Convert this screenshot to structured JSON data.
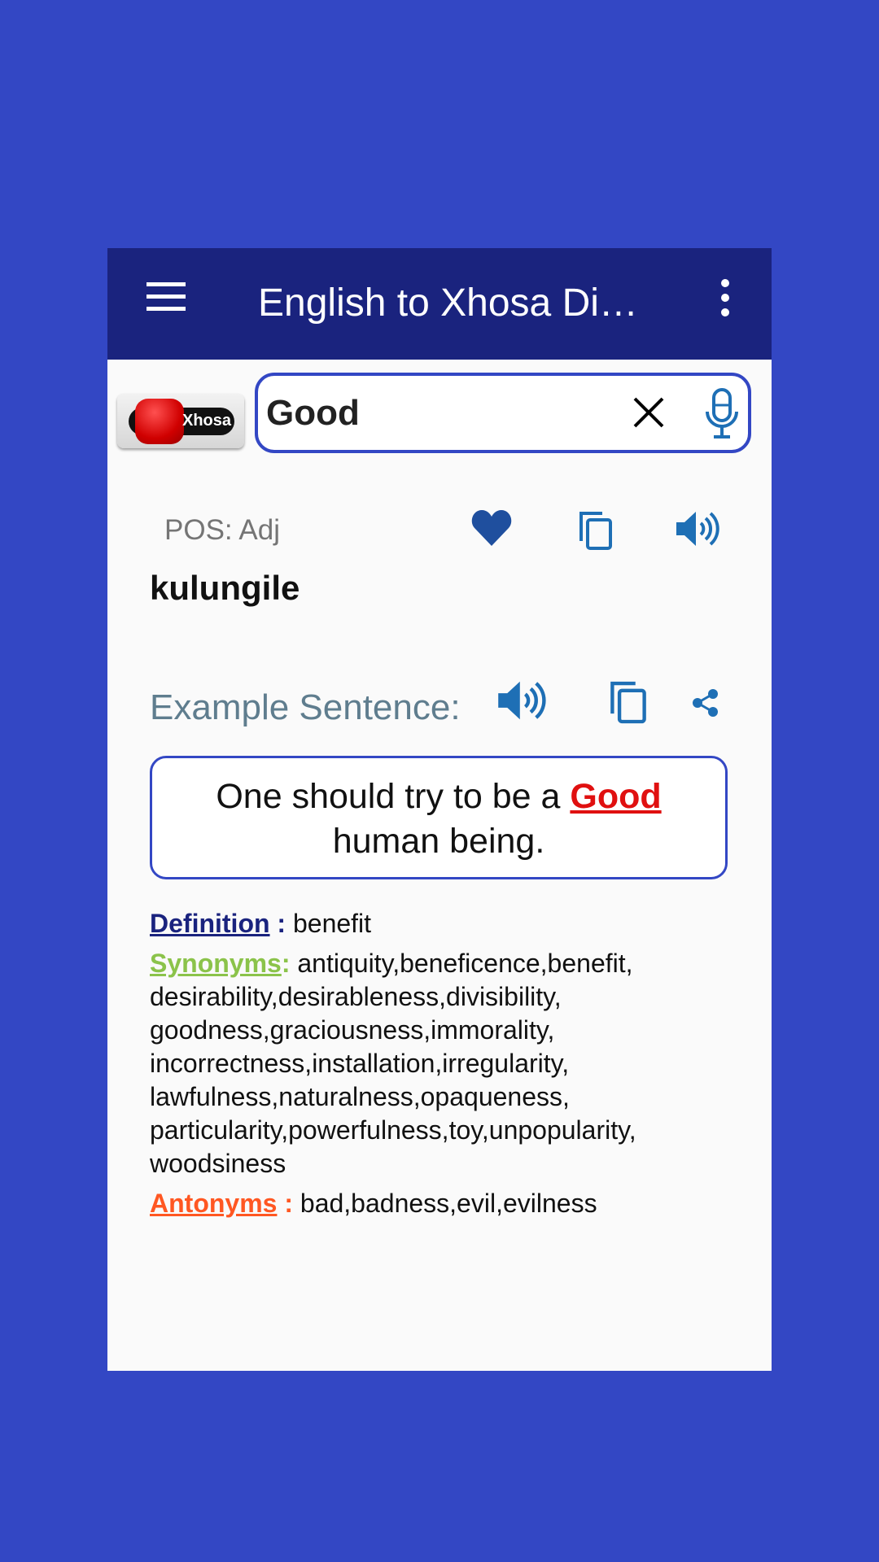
{
  "appbar": {
    "title": "English to Xhosa Di…",
    "menu_icon": "hamburger-icon",
    "more_icon": "more-vert-icon"
  },
  "logo": {
    "text": "Xhosa"
  },
  "search": {
    "value": "Good"
  },
  "result": {
    "pos": "POS: Adj",
    "translation": "kulungile"
  },
  "example": {
    "label": "Example Sentence:",
    "before": "One should try to be a ",
    "highlight": "Good",
    "after": " human being."
  },
  "details": {
    "definition_label": "Definition",
    "definition_sep": " : ",
    "definition": "benefit",
    "synonyms_label": "Synonyms",
    "synonyms_sep": ": ",
    "synonyms": "antiquity,beneficence,benefit, desirability,desirableness,divisibility, goodness,graciousness,immorality, incorrectness,installation,irregularity, lawfulness,naturalness,opaqueness, particularity,powerfulness,toy,unpopularity, woodsiness",
    "antonyms_label": "Antonyms",
    "antonyms_sep": " : ",
    "antonyms": "bad,badness,evil,evilness"
  },
  "colors": {
    "background": "#3347c4",
    "appbar": "#1a237e",
    "icon": "#1e6fb5",
    "highlight": "#e01010",
    "definition": "#1a237e",
    "synonyms": "#8bc34a",
    "antonyms": "#ff5722"
  }
}
